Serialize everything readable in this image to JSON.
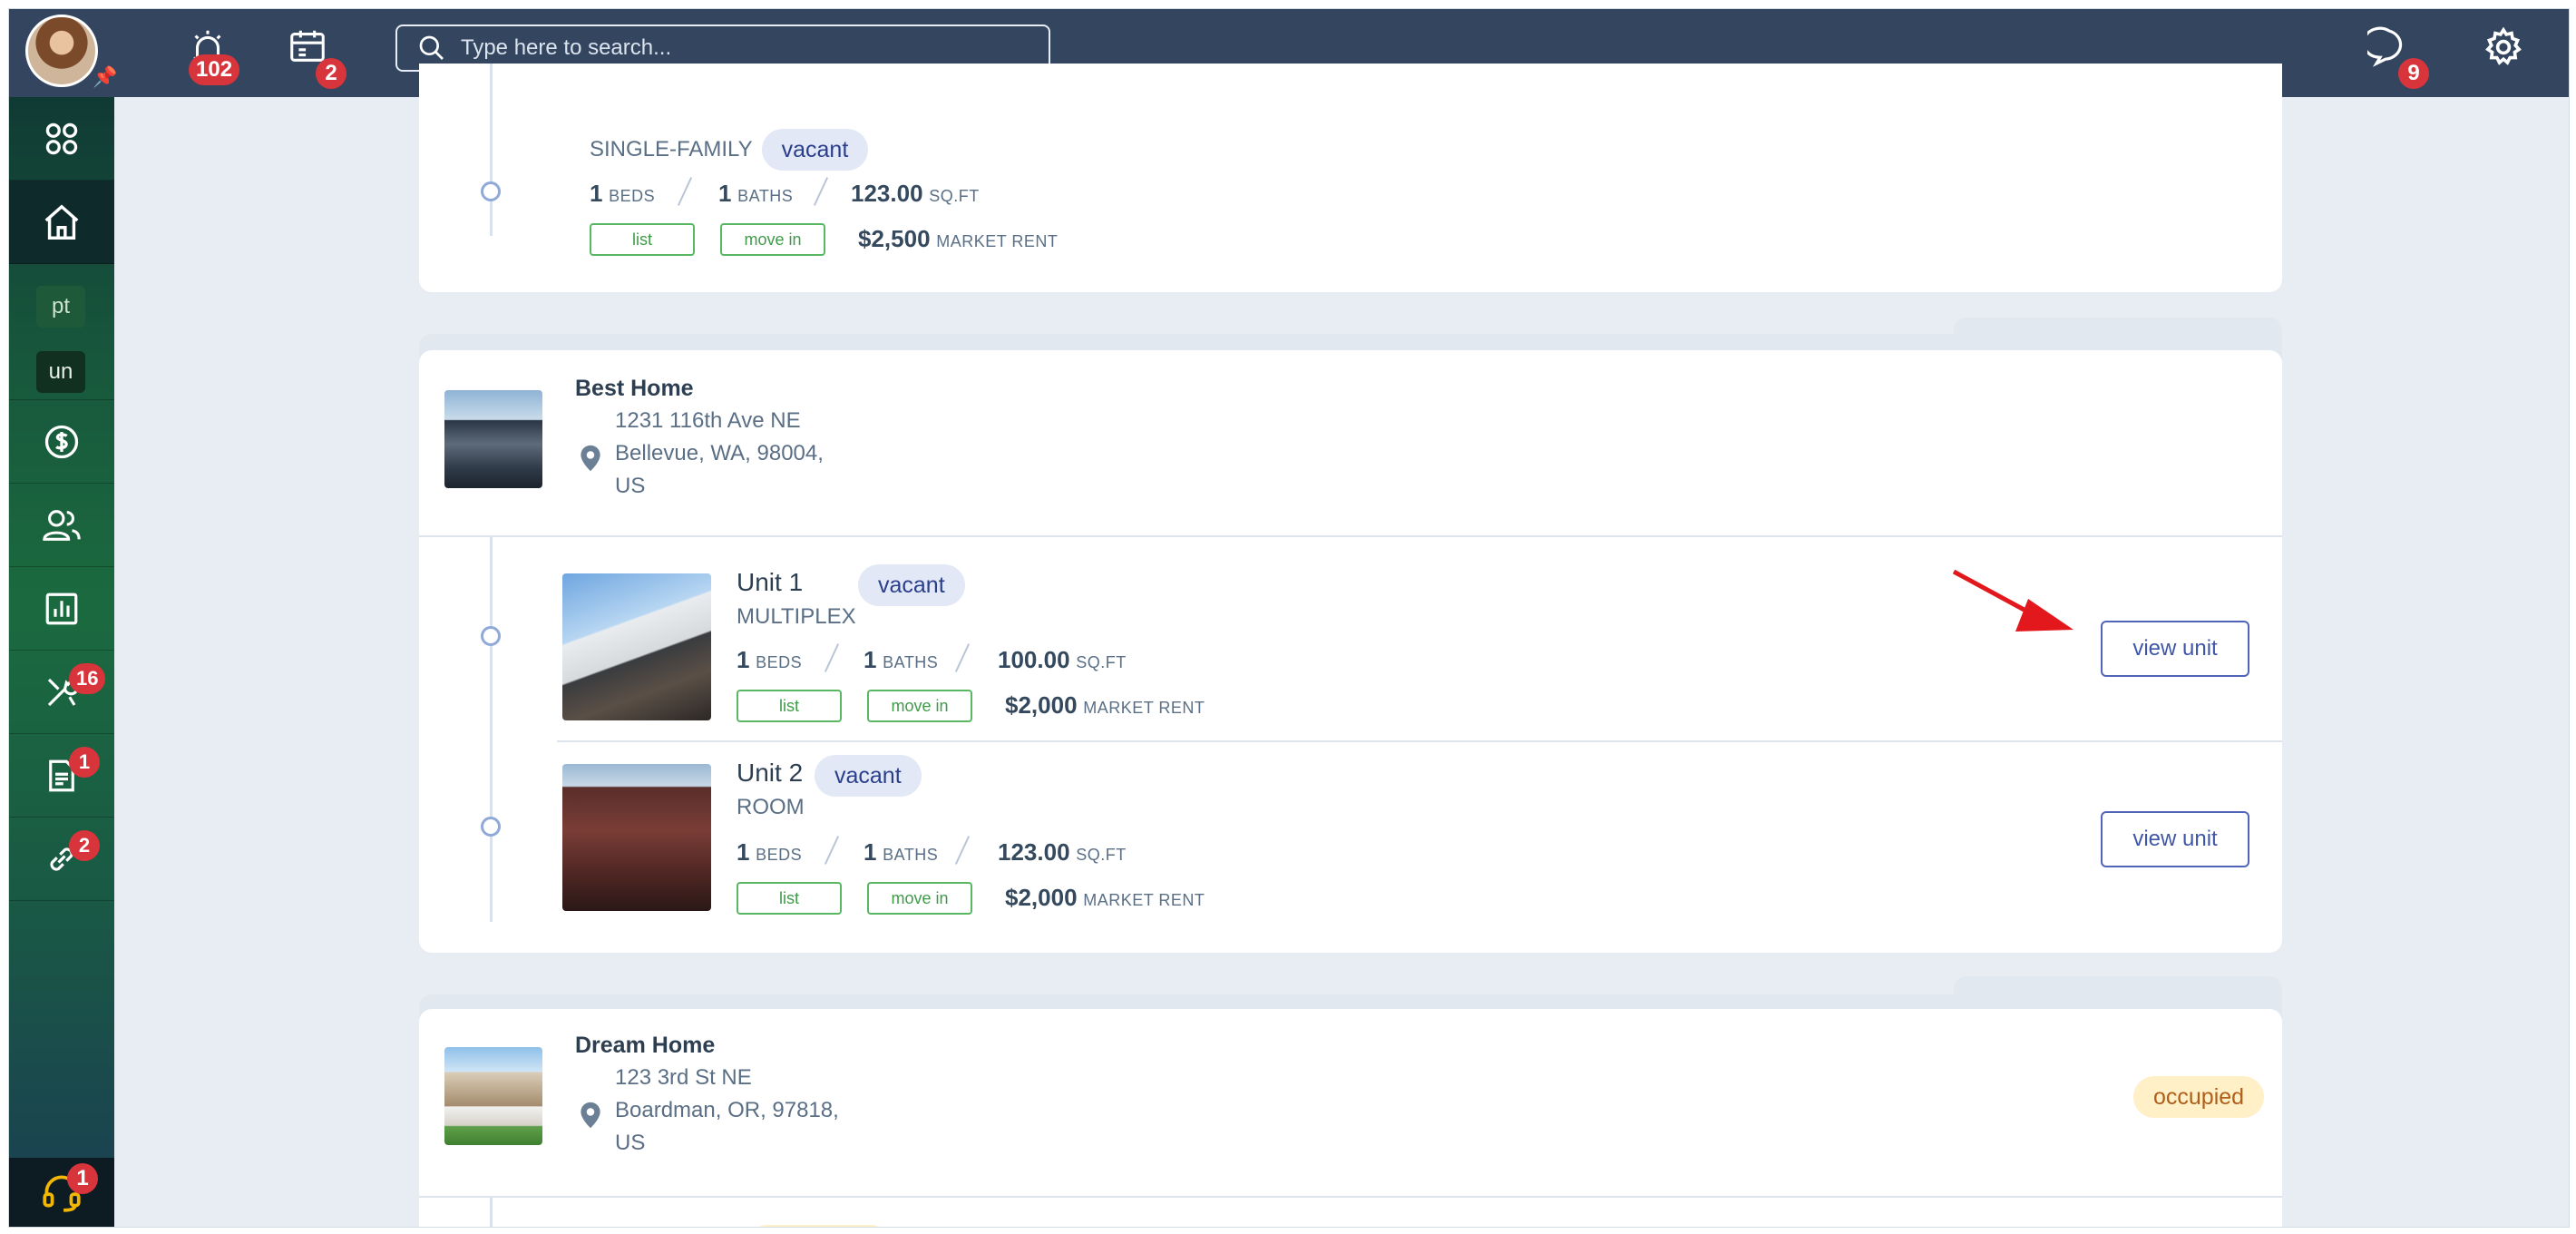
{
  "topbar": {
    "alerts_count": "102",
    "calendar_count": "2",
    "search_placeholder": "Type here to search...",
    "messages_count": "9"
  },
  "sidebar": {
    "chips": [
      "pt",
      "un"
    ],
    "badges": {
      "maintenance": "16",
      "documents": "1",
      "links": "2",
      "support": "1"
    }
  },
  "prev_unit": {
    "type": "SINGLE-FAMILY",
    "status": "vacant",
    "beds": "1",
    "beds_label": "BEDS",
    "baths": "1",
    "baths_label": "BATHS",
    "area": "123.00",
    "area_label": "SQ.FT",
    "list_label": "list",
    "move_in_label": "move in",
    "rent": "$2,500",
    "rent_label": "MARKET RENT"
  },
  "property_best": {
    "name": "Best Home",
    "address_line1": "1231 116th Ave NE",
    "address_line2": "Bellevue, WA, 98004,",
    "address_line3": "US",
    "units": [
      {
        "name": "Unit 1",
        "type": "MULTIPLEX",
        "status": "vacant",
        "beds": "1",
        "beds_label": "BEDS",
        "baths": "1",
        "baths_label": "BATHS",
        "area": "100.00",
        "area_label": "SQ.FT",
        "list_label": "list",
        "move_in_label": "move in",
        "rent": "$2,000",
        "rent_label": "MARKET RENT",
        "view_label": "view unit"
      },
      {
        "name": "Unit 2",
        "type": "ROOM",
        "status": "vacant",
        "beds": "1",
        "beds_label": "BEDS",
        "baths": "1",
        "baths_label": "BATHS",
        "area": "123.00",
        "area_label": "SQ.FT",
        "list_label": "list",
        "move_in_label": "move in",
        "rent": "$2,000",
        "rent_label": "MARKET RENT",
        "view_label": "view unit"
      }
    ]
  },
  "property_dream": {
    "name": "Dream Home",
    "address_line1": "123 3rd St NE",
    "address_line2": "Boardman, OR, 97818,",
    "address_line3": "US",
    "status": "occupied"
  },
  "colors": {
    "topbar": "#34465f",
    "accent": "#5064b8",
    "badge": "#d8343c",
    "green": "#59b763",
    "arrow": "#e3181d"
  }
}
